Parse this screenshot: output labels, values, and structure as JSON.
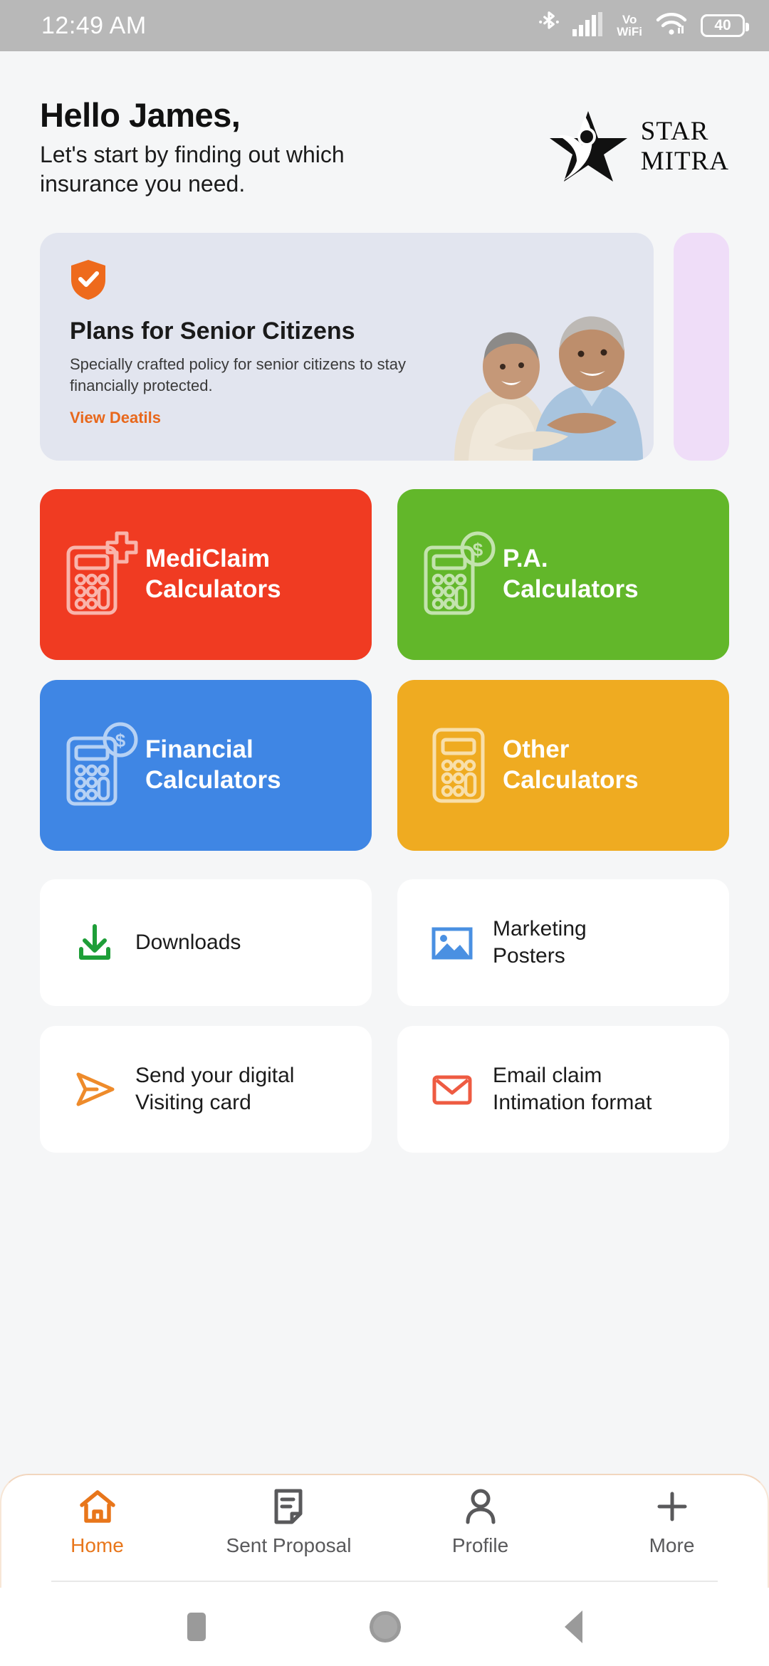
{
  "statusbar": {
    "time": "12:49 AM",
    "bluetooth_icon": "bluetooth-icon",
    "signal_icon": "cellular-signal-icon",
    "vowifi_line1": "Vo",
    "vowifi_line2": "WiFi",
    "wifi_icon": "wifi-icon",
    "battery_level": "40"
  },
  "header": {
    "greeting": "Hello James,",
    "subtitle": "Let's start by finding out which insurance you need.",
    "logo_line1": "STAR",
    "logo_line2": "MITRA"
  },
  "banner": {
    "icon": "shield-check-icon",
    "title": "Plans for Senior Citizens",
    "description": "Specially crafted policy for senior citizens to stay financially protected.",
    "link_label": "View Deatils",
    "photo": "senior-couple-photo",
    "bg_color": "#E2E5EF",
    "next_card_color": "#EFDDF8"
  },
  "tiles": [
    {
      "label_line1": "MediClaim",
      "label_line2": "Calculators",
      "color": "#F03B22",
      "icon": "calculator-medical-icon"
    },
    {
      "label_line1": "P.A.",
      "label_line2": "Calculators",
      "color": "#62B72A",
      "icon": "calculator-dollar-icon"
    },
    {
      "label_line1": "Financial",
      "label_line2": "Calculators",
      "color": "#3F86E4",
      "icon": "calculator-dollar-icon"
    },
    {
      "label_line1": "Other",
      "label_line2": "Calculators",
      "color": "#EFAB21",
      "icon": "calculator-icon"
    }
  ],
  "actions": [
    {
      "label_line1": "Downloads",
      "label_line2": "",
      "icon": "download-icon",
      "color": "#1E9E38"
    },
    {
      "label_line1": "Marketing",
      "label_line2": "Posters",
      "icon": "image-icon",
      "color": "#4A90E2"
    },
    {
      "label_line1": "Send your digital",
      "label_line2": "Visiting card",
      "icon": "send-icon",
      "color": "#EE8B2B"
    },
    {
      "label_line1": "Email claim",
      "label_line2": "Intimation format",
      "icon": "email-icon",
      "color": "#EE5B42"
    }
  ],
  "bottomnav": {
    "active_color": "#E8761B",
    "items": [
      {
        "label": "Home",
        "icon": "home-icon",
        "active": true
      },
      {
        "label": "Sent Proposal",
        "icon": "document-icon",
        "active": false
      },
      {
        "label": "Profile",
        "icon": "person-icon",
        "active": false
      },
      {
        "label": "More",
        "icon": "plus-icon",
        "active": false
      }
    ]
  },
  "androidnav": {
    "recents": "square-recents-icon",
    "home": "circle-home-icon",
    "back": "triangle-back-icon"
  }
}
